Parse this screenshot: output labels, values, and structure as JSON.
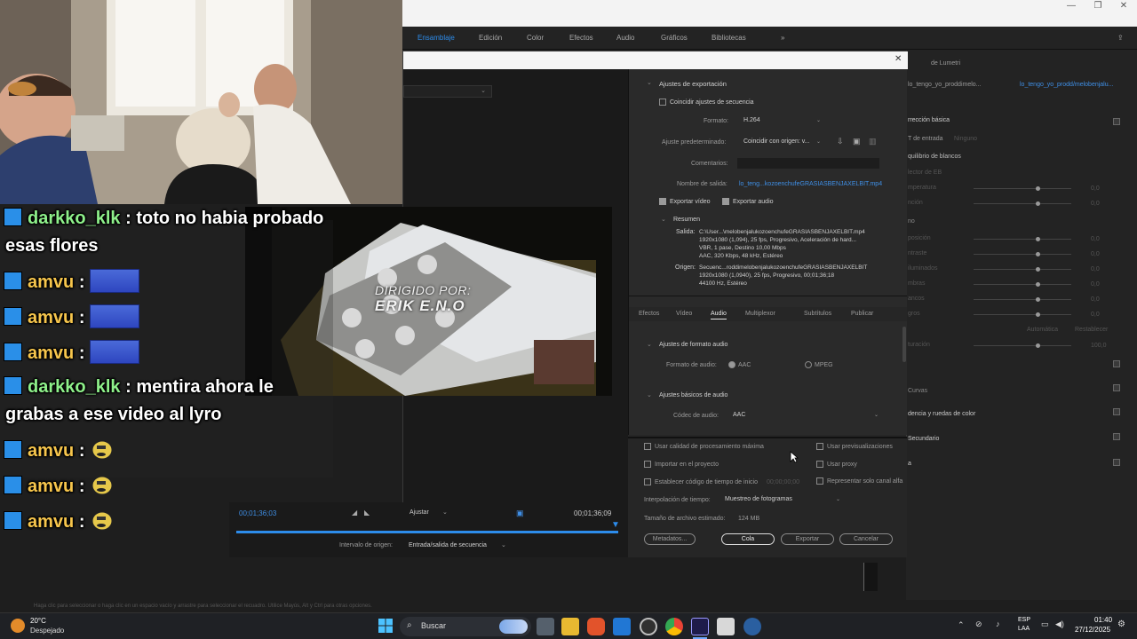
{
  "workspaces": [
    "Ensamblaje",
    "Edición",
    "Color",
    "Efectos",
    "Audio",
    "Gráficos",
    "Bibliotecas"
  ],
  "lumetri": {
    "seq_name": "lo_tengo_yo_proddimelo...",
    "clip_name": "lo_tengo_yo_prodd/melobenjalu...",
    "header": "de Lumetri",
    "correccion_basica": "rrección básica",
    "entrada": "T de entrada",
    "entrada_value": "Ninguno",
    "equilibrio": "quilibrio de blancos",
    "selector": "lector de EB",
    "rows": [
      "mperatura",
      "nción",
      "no",
      "posición",
      "ntraste",
      "iluminados",
      "mbras",
      "ancos",
      "gros"
    ],
    "zeros": [
      "0,0",
      "0,0",
      "0,0",
      "0,0",
      "0,0",
      "0,0",
      "0,0",
      "0,0",
      "0,0"
    ],
    "saturacion": "turación",
    "automatica": "Automática",
    "restablecer": "Restablecer",
    "cien": "100,0",
    "curvas": "Curvas",
    "ruedas": "dencia y ruedas de color",
    "secundario": "Secundario",
    "a": "a"
  },
  "export": {
    "section_title": "Ajustes de exportación",
    "coincidir": "Coincidir ajustes de secuencia",
    "formato_label": "Formato:",
    "formato_value": "H.264",
    "ajuste_label": "Ajuste predeterminado:",
    "ajuste_value": "Coincidir con origen: v...",
    "comentarios_label": "Comentarios:",
    "nombre_label": "Nombre de salida:",
    "nombre_value": "lo_teng...kozoenchufeGRASIASBENJAXELBIT.mp4",
    "exportar_video": "Exportar vídeo",
    "exportar_audio": "Exportar audio",
    "resumen": "Resumen",
    "salida_label": "Salida:",
    "salida_lines": [
      "C:\\User...\\melobenjalukozoenchufeGRASIASBENJAXELBIT.mp4",
      "1920x1080 (1,094), 25 fps, Progresivo, Aceleración de hard...",
      "VBR, 1 pase, Destino 10,00 Mbps",
      "AAC, 320 Kbps, 48 kHz, Estéreo"
    ],
    "origen_label": "Origen:",
    "origen_lines": [
      "Secuenc...roddimelobenjalukozoenchufeGRASIASBENJAXELBIT",
      "1920x1080 (1,0940), 25 fps, Progresivo, 00;01;36;18",
      "44100 Hz, Estéreo"
    ],
    "tabs": [
      "Efectos",
      "Vídeo",
      "Audio",
      "Multiplexor",
      "Subtítulos",
      "Publicar"
    ],
    "formato_audio_header": "Ajustes de formato audio",
    "formato_audio_label": "Formato de audio:",
    "aac": "AAC",
    "mpeg": "MPEG",
    "basicos_header": "Ajustes básicos de audio",
    "codec_label": "Códec de audio:",
    "codec_value": "AAC",
    "opt_calidad": "Usar calidad de procesamiento máxima",
    "opt_previs": "Usar previsualizaciones",
    "opt_importar": "Importar en el proyecto",
    "opt_proxy": "Usar proxy",
    "opt_codigo": "Establecer código de tiempo de inicio",
    "codigo_value": "00;00;00;00",
    "opt_alfa": "Representar solo canal alfa",
    "interp_label": "Interpolación de tiempo:",
    "interp_value": "Muestreo de fotogramas",
    "tamano_label": "Tamaño de archivo estimado:",
    "tamano_value": "124 MB",
    "btn_metadatos": "Metadatos...",
    "btn_cola": "Cola",
    "btn_exportar": "Exportar",
    "btn_cancelar": "Cancelar"
  },
  "preview": {
    "time_in": "00;01;36;03",
    "time_out": "00;01;36;09",
    "ajustar": "Ajustar",
    "intervalo_label": "Intervalo de origen:",
    "intervalo_value": "Entrada/salida de secuencia",
    "credit_line1": "DIRIGIDO POR:",
    "credit_line2": "ERIK E.N.O"
  },
  "chat": [
    {
      "user": "darkko_klk",
      "sep": ":",
      "text": "toto no habia probado",
      "text2": "esas flores",
      "color": "green"
    },
    {
      "user": "amvu",
      "sep": ":",
      "emote": "wide"
    },
    {
      "user": "amvu",
      "sep": ":",
      "emote": "wide"
    },
    {
      "user": "amvu",
      "sep": ":",
      "emote": "wide"
    },
    {
      "user": "darkko_klk",
      "sep": ":",
      "text": "mentira ahora le",
      "text2": "grabas a ese video al lyro",
      "color": "green"
    },
    {
      "user": "amvu",
      "sep": ":",
      "emote": "face"
    },
    {
      "user": "amvu",
      "sep": ":",
      "emote": "face"
    },
    {
      "user": "amvu",
      "sep": ":",
      "emote": "face"
    }
  ],
  "status_strip": "Haga clic para seleccionar o haga clic en un espacio vacío y arrastre para seleccionar el recuadro. Utilice Mayús, Alt y Ctrl para otras opciones.",
  "taskbar": {
    "weather_temp": "20°C",
    "weather_desc": "Despejado",
    "search": "Buscar",
    "lang1": "ESP",
    "lang2": "LAA",
    "time": "01:40",
    "date": "27/12/2025"
  }
}
